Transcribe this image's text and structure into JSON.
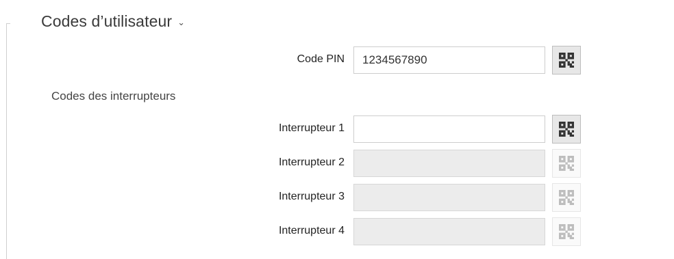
{
  "section": {
    "title": "Codes d’utilisateur",
    "chevron": "⌄"
  },
  "pin": {
    "label": "Code PIN",
    "value": "1234567890",
    "qr_icon": "qr-code-icon",
    "enabled": true
  },
  "switches": {
    "heading": "Codes des interrupteurs",
    "items": [
      {
        "label": "Interrupteur 1",
        "value": "",
        "enabled": true
      },
      {
        "label": "Interrupteur 2",
        "value": "",
        "enabled": false
      },
      {
        "label": "Interrupteur 3",
        "value": "",
        "enabled": false
      },
      {
        "label": "Interrupteur 4",
        "value": "",
        "enabled": false
      }
    ]
  },
  "colors": {
    "qr_enabled": "#333333",
    "qr_disabled": "#bdbdbd"
  }
}
